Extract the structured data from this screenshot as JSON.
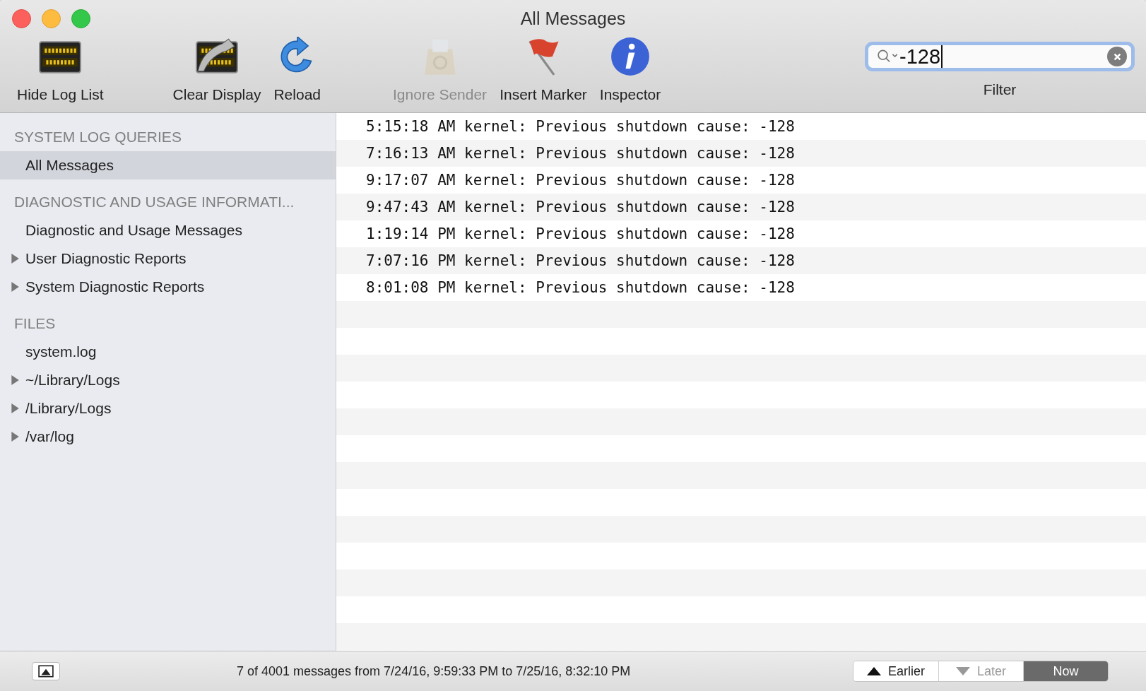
{
  "window": {
    "title": "All Messages"
  },
  "toolbar": [
    {
      "kind": "hide-log",
      "label": "Hide Log List",
      "disabled": false
    },
    {
      "kind": "clear",
      "label": "Clear Display",
      "disabled": false
    },
    {
      "kind": "reload",
      "label": "Reload",
      "disabled": false
    },
    {
      "kind": "ignore",
      "label": "Ignore Sender",
      "disabled": true
    },
    {
      "kind": "marker",
      "label": "Insert Marker",
      "disabled": false
    },
    {
      "kind": "inspector",
      "label": "Inspector",
      "disabled": false
    }
  ],
  "filter": {
    "value": "-128",
    "label": "Filter"
  },
  "sidebar": [
    {
      "heading": "SYSTEM LOG QUERIES",
      "items": [
        {
          "label": "All Messages",
          "selected": true
        }
      ]
    },
    {
      "heading": "DIAGNOSTIC AND USAGE INFORMATI...",
      "items": [
        {
          "label": "Diagnostic and Usage Messages",
          "selected": false
        },
        {
          "label": "User Diagnostic Reports",
          "selected": false,
          "expanded": false
        },
        {
          "label": "System Diagnostic Reports",
          "selected": false,
          "expanded": false
        }
      ]
    },
    {
      "heading": "FILES",
      "items": [
        {
          "label": "system.log",
          "selected": false
        },
        {
          "label": "~/Library/Logs",
          "selected": false,
          "expanded": false
        },
        {
          "label": "/Library/Logs",
          "selected": false,
          "expanded": false
        },
        {
          "label": "/var/log",
          "selected": false,
          "expanded": false
        }
      ]
    }
  ],
  "messages": [
    {
      "time": "5:15:18 AM",
      "text": "kernel: Previous shutdown cause: -128"
    },
    {
      "time": "7:16:13 AM",
      "text": "kernel: Previous shutdown cause: -128"
    },
    {
      "time": "9:17:07 AM",
      "text": "kernel: Previous shutdown cause: -128"
    },
    {
      "time": "9:47:43 AM",
      "text": "kernel: Previous shutdown cause: -128"
    },
    {
      "time": "1:19:14 PM",
      "text": "kernel: Previous shutdown cause: -128"
    },
    {
      "time": "7:07:16 PM",
      "text": "kernel: Previous shutdown cause: -128"
    },
    {
      "time": "8:01:08 PM",
      "text": "kernel: Previous shutdown cause: -128"
    }
  ],
  "status_bar": {
    "text": "7 of 4001 messages from 7/24/16, 9:59:33 PM to 7/25/16, 8:32:10 PM",
    "nav": [
      {
        "kind": "up",
        "label": "Earlier",
        "disabled": false,
        "selected": false
      },
      {
        "kind": "down",
        "label": "Later",
        "disabled": true,
        "selected": false
      },
      {
        "kind": "none",
        "label": "Now",
        "disabled": false,
        "selected": true
      }
    ]
  }
}
